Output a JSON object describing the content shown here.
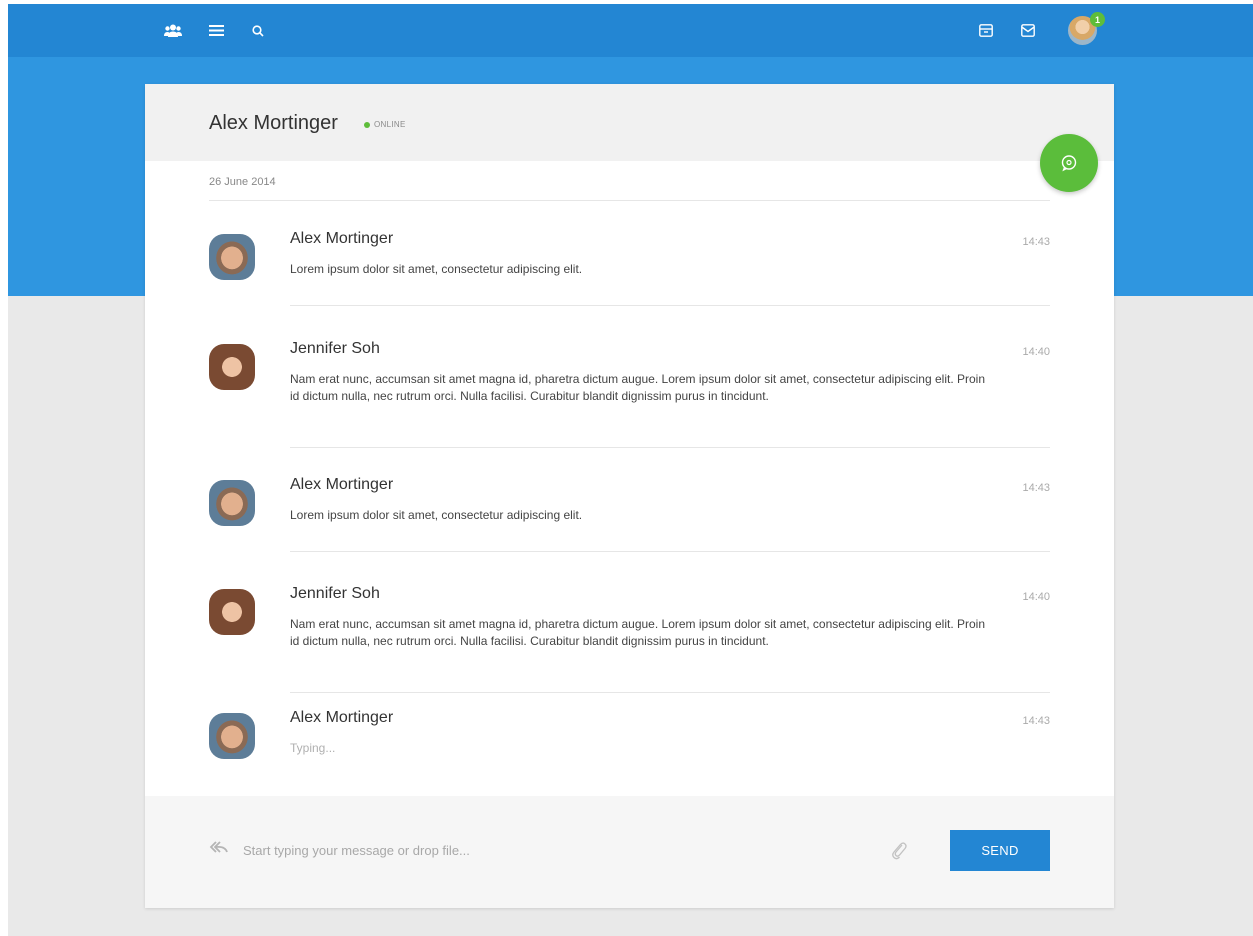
{
  "topbar": {
    "notification_count": "1",
    "icons": [
      "groups-icon",
      "menu-icon",
      "search-icon",
      "archive-icon",
      "mail-icon"
    ]
  },
  "conversation": {
    "contact_name": "Alex Mortinger",
    "status": "ONLINE",
    "date": "26 June 2014"
  },
  "messages": [
    {
      "author": "Alex Mortinger",
      "time": "14:43",
      "text": "Lorem ipsum dolor sit amet, consectetur adipiscing elit."
    },
    {
      "author": "Jennifer Soh",
      "time": "14:40",
      "text": "Nam erat nunc, accumsan sit amet magna id, pharetra dictum augue. Lorem ipsum dolor sit amet, consectetur adipiscing elit. Proin id dictum nulla, nec rutrum orci. Nulla facilisi. Curabitur blandit dignissim purus in tincidunt."
    },
    {
      "author": "Alex Mortinger",
      "time": "14:43",
      "text": "Lorem ipsum dolor sit amet, consectetur adipiscing elit."
    },
    {
      "author": "Jennifer Soh",
      "time": "14:40",
      "text": "Nam erat nunc, accumsan sit amet magna id, pharetra dictum augue. Lorem ipsum dolor sit amet, consectetur adipiscing elit. Proin id dictum nulla, nec rutrum orci. Nulla facilisi. Curabitur blandit dignissim purus in tincidunt."
    },
    {
      "author": "Alex Mortinger",
      "time": "14:43",
      "text": "Typing..."
    }
  ],
  "composer": {
    "placeholder": "Start typing your message or drop file...",
    "value": "",
    "send_label": "SEND"
  },
  "colors": {
    "topbar": "#2386d3",
    "hero": "#2f96e0",
    "online": "#5ebd3a",
    "fab": "#5bbd3b",
    "send": "#2386d3"
  }
}
